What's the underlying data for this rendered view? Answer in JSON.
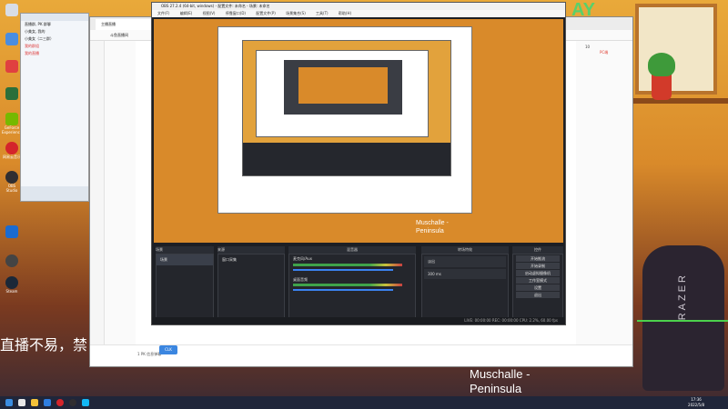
{
  "desktop": {
    "icons": [
      "GeForce Experience",
      "网易云音乐",
      "OBS Studio",
      "Steam"
    ],
    "overlay_subtitle": "直播不易，禁",
    "music_line1": "Muschalle -",
    "music_line2": "Peninsula",
    "wallpaper_text_ay": "AY",
    "razer_text": "RAZER"
  },
  "chat": {
    "items": [
      "直播群, PK 群聊",
      "小美女, 我的",
      "小美女（二三群）",
      "我的群组",
      "我的直播"
    ]
  },
  "browser": {
    "tab_title": "主播直播",
    "address": "斗鱼直播间",
    "right_count": "10",
    "right_label": "PC端",
    "input_placeholder": "1 PK 信息弹幕",
    "badge": "CLK"
  },
  "obs": {
    "title": "OBS 27.2.4 (64-bit, windows) - 配置文件: 未命名 - 场景: 未命名",
    "menu": [
      "文件(F)",
      "编辑(E)",
      "视图(V)",
      "停靠窗口(D)",
      "配置文件(P)",
      "场景集合(S)",
      "工具(T)",
      "帮助(H)"
    ],
    "docks": {
      "scenes": "场景",
      "sources": "来源",
      "mixer": "混音器",
      "transitions": "转场特效",
      "controls": "控件"
    },
    "scene_item": "场景",
    "source_item": "窗口采集",
    "mixer_ch1": "麦克风/Aux",
    "mixer_ch2": "桌面音频",
    "transition_value": "淡出",
    "duration_value": "300 ms",
    "controls": [
      "开始推流",
      "开始录制",
      "启动虚拟摄像机",
      "工作室模式",
      "设置",
      "退出"
    ],
    "status": "LIVE: 00:00:00  REC: 00:00:00  CPU: 2.2%, 60.00 fps"
  },
  "taskbar": {
    "time": "17:36",
    "date": "2022/5/8"
  }
}
